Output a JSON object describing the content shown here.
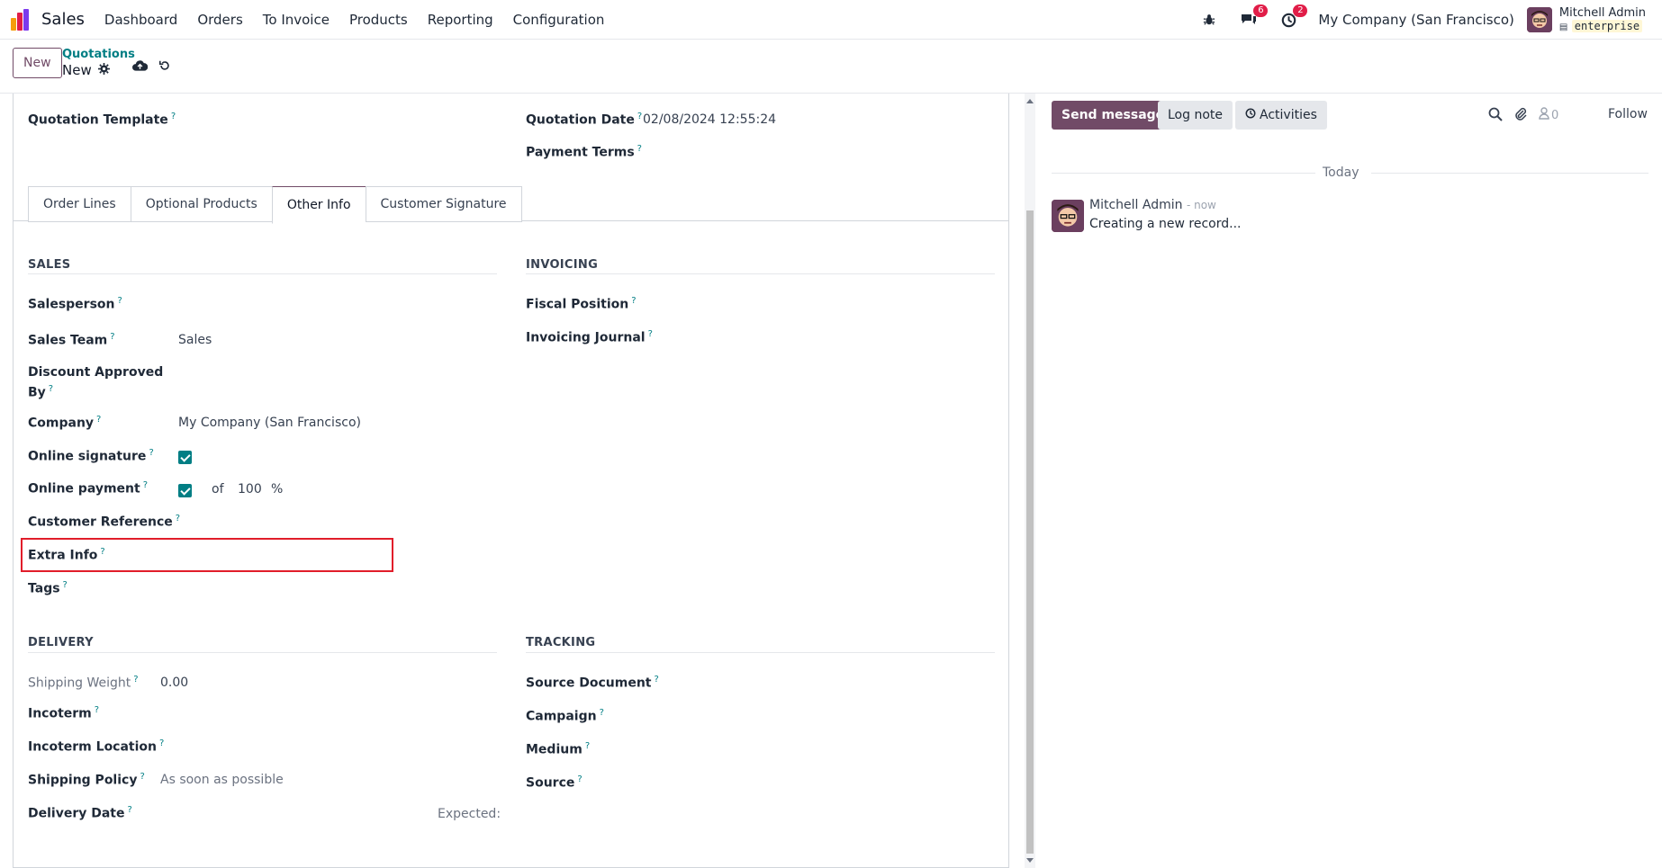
{
  "navbar": {
    "app_title": "Sales",
    "menu": [
      "Dashboard",
      "Orders",
      "To Invoice",
      "Products",
      "Reporting",
      "Configuration"
    ],
    "messages_count": "6",
    "activities_count": "2",
    "company": "My Company (San Francisco)",
    "user_name": "Mitchell Admin",
    "database": "enterprise"
  },
  "control": {
    "new_label": "New",
    "breadcrumb_parent": "Quotations",
    "breadcrumb_current": "New"
  },
  "header_fields": {
    "quotation_template_label": "Quotation Template",
    "quotation_date_label": "Quotation Date",
    "quotation_date_value": "02/08/2024 12:55:24",
    "payment_terms_label": "Payment Terms"
  },
  "tabs": [
    "Order Lines",
    "Optional Products",
    "Other Info",
    "Customer Signature"
  ],
  "sales": {
    "title": "SALES",
    "salesperson_label": "Salesperson",
    "sales_team_label": "Sales Team",
    "sales_team_value": "Sales",
    "discount_label_1": "Discount Approved",
    "discount_label_2": "By",
    "company_label": "Company",
    "company_value": "My Company (San Francisco)",
    "online_signature_label": "Online signature",
    "online_payment_label": "Online payment",
    "online_payment_of": "of",
    "online_payment_percent": "100",
    "percent_sign": "%",
    "customer_reference_label": "Customer Reference",
    "extra_info_label": "Extra Info",
    "tags_label": "Tags"
  },
  "invoicing": {
    "title": "INVOICING",
    "fiscal_position_label": "Fiscal Position",
    "invoicing_journal_label": "Invoicing Journal"
  },
  "delivery": {
    "title": "DELIVERY",
    "shipping_weight_label": "Shipping Weight",
    "shipping_weight_value": "0.00",
    "incoterm_label": "Incoterm",
    "incoterm_location_label": "Incoterm Location",
    "shipping_policy_label": "Shipping Policy",
    "shipping_policy_value": "As soon as possible",
    "delivery_date_label": "Delivery Date",
    "expected_label": "Expected:"
  },
  "tracking": {
    "title": "TRACKING",
    "source_document_label": "Source Document",
    "campaign_label": "Campaign",
    "medium_label": "Medium",
    "source_label": "Source"
  },
  "chatter": {
    "send_message": "Send message",
    "log_note": "Log note",
    "activities": "Activities",
    "followers_count": "0",
    "follow": "Follow",
    "today": "Today",
    "message_author": "Mitchell Admin",
    "message_time": "- now",
    "message_body": "Creating a new record..."
  },
  "colors": {
    "brand": "#714b67",
    "accent": "#017e84",
    "highlight": "#e11d2a"
  }
}
